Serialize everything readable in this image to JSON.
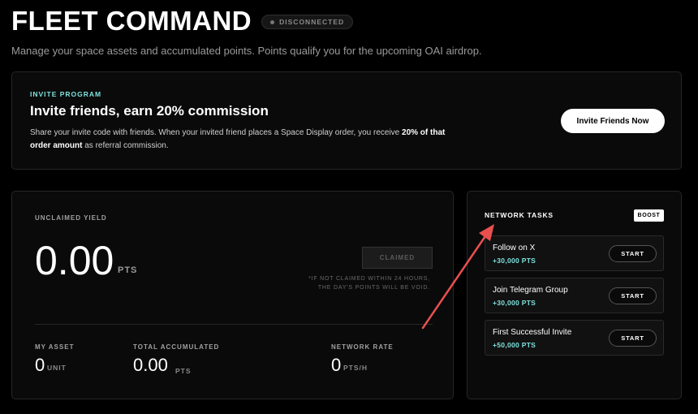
{
  "header": {
    "title": "FLEET COMMAND",
    "status": "DISCONNECTED",
    "subtitle": "Manage your space assets and accumulated points. Points qualify you for the upcoming OAI airdrop."
  },
  "invite": {
    "eyebrow": "INVITE PROGRAM",
    "heading": "Invite friends, earn 20% commission",
    "desc_pre": "Share your invite code with friends. When your invited friend places a Space Display order, you receive ",
    "desc_bold": "20% of that order amount",
    "desc_post": " as referral commission.",
    "button": "Invite Friends Now"
  },
  "yield": {
    "label": "UNCLAIMED YIELD",
    "value": "0.00",
    "unit": "PTS",
    "claim_button": "CLAIMED",
    "note_line1": "*IF NOT CLAIMED WITHIN 24 HOURS,",
    "note_line2": "THE DAY'S POINTS WILL BE VOID.",
    "stats": [
      {
        "label": "MY ASSET",
        "value": "0",
        "unit": "UNIT"
      },
      {
        "label": "TOTAL ACCUMULATED",
        "value": "0.00",
        "unit": "PTS"
      },
      {
        "label": "NETWORK RATE",
        "value": "0",
        "unit": "PTS/H"
      }
    ]
  },
  "tasks": {
    "title": "NETWORK TASKS",
    "badge": "BOOST",
    "items": [
      {
        "name": "Follow on X",
        "points": "+30,000 PTS",
        "action": "START"
      },
      {
        "name": "Join Telegram Group",
        "points": "+30,000 PTS",
        "action": "START"
      },
      {
        "name": "First Successful Invite",
        "points": "+50,000 PTS",
        "action": "START"
      }
    ]
  },
  "colors": {
    "accent_teal": "#7fe3df",
    "annotation_arrow": "#e8504f",
    "background": "#000000"
  }
}
